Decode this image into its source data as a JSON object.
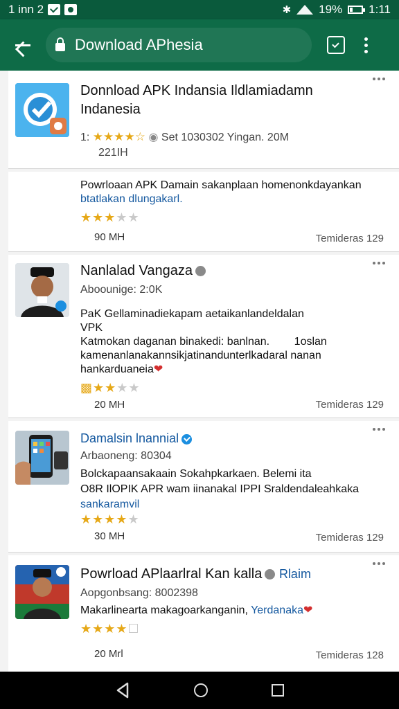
{
  "status_bar": {
    "left_text": "1 inn 2",
    "battery": "19%",
    "time": "1:11",
    "icons": [
      "check-icon",
      "photo-icon",
      "bluetooth-icon",
      "wifi-icon",
      "battery-icon"
    ]
  },
  "toolbar": {
    "url": "Download APhesia",
    "icons": [
      "back-arrow-icon",
      "lock-icon",
      "share-icon",
      "overflow-icon"
    ]
  },
  "results": [
    {
      "title": "Donnload APK Indansia Ildlamiadamn Indanesia",
      "meta_line1": "1:",
      "meta_line1_rest": "Set 1030302 Yingan. 20M",
      "meta_line2": "221IH",
      "stars": [
        1,
        1,
        1,
        1,
        0.5
      ]
    },
    {
      "desc_black": "Powrloaan APK Damain sakanplaan homenonkdayankan",
      "desc_blue": "btatlakan dlungakarl.",
      "stars": [
        1,
        1,
        1,
        0,
        0
      ],
      "size": "90 MH",
      "tag": "Temideras 129"
    },
    {
      "title": "Nanlalad Vangaza",
      "meta": "Aboounige: 2:0K",
      "desc1": "PaK Gellaminadiekapam aetaikanlandeldalan",
      "desc2": "VPK",
      "desc3": "Katmokan daganan binakedi: banlnan.",
      "desc3b": "1oslan",
      "desc4": "kamenanlanakannsikjatinandunterlkadaral nanan",
      "desc5": "hankarduaneia",
      "stars": [
        1,
        1,
        0.5,
        0,
        0
      ],
      "size": "20 MH",
      "tag": "Temideras 129"
    },
    {
      "title": "Damalsin lnannial",
      "meta": "Arbaoneng: 80304",
      "desc1": "Bolckapaansakaain Sokahpkarkaen. Belemi ita",
      "desc2": "O8R IlOPIK APR wam iinanakal IPPI Sraldendaleahkaka",
      "desc3": "sankaramvil",
      "stars": [
        1,
        1,
        1,
        1,
        0.5
      ],
      "size": "30 MH",
      "tag": "Temideras 129"
    },
    {
      "title": "Powrload APlaarlral Kan kalla",
      "title_blue": "Rlaim",
      "meta": "Aopgonbsang: 8002398",
      "desc_black": "Makarlinearta makagoarkanganin,",
      "desc_blue": "Yerdanaka",
      "stars": [
        1,
        1,
        1,
        0.5,
        0
      ],
      "size": "20 Mrl",
      "tag": "Temideras 128"
    }
  ],
  "colors": {
    "toolbar": "#0e6b47",
    "status": "#0a5a3c",
    "star": "#e6a817",
    "link": "#14589f"
  }
}
